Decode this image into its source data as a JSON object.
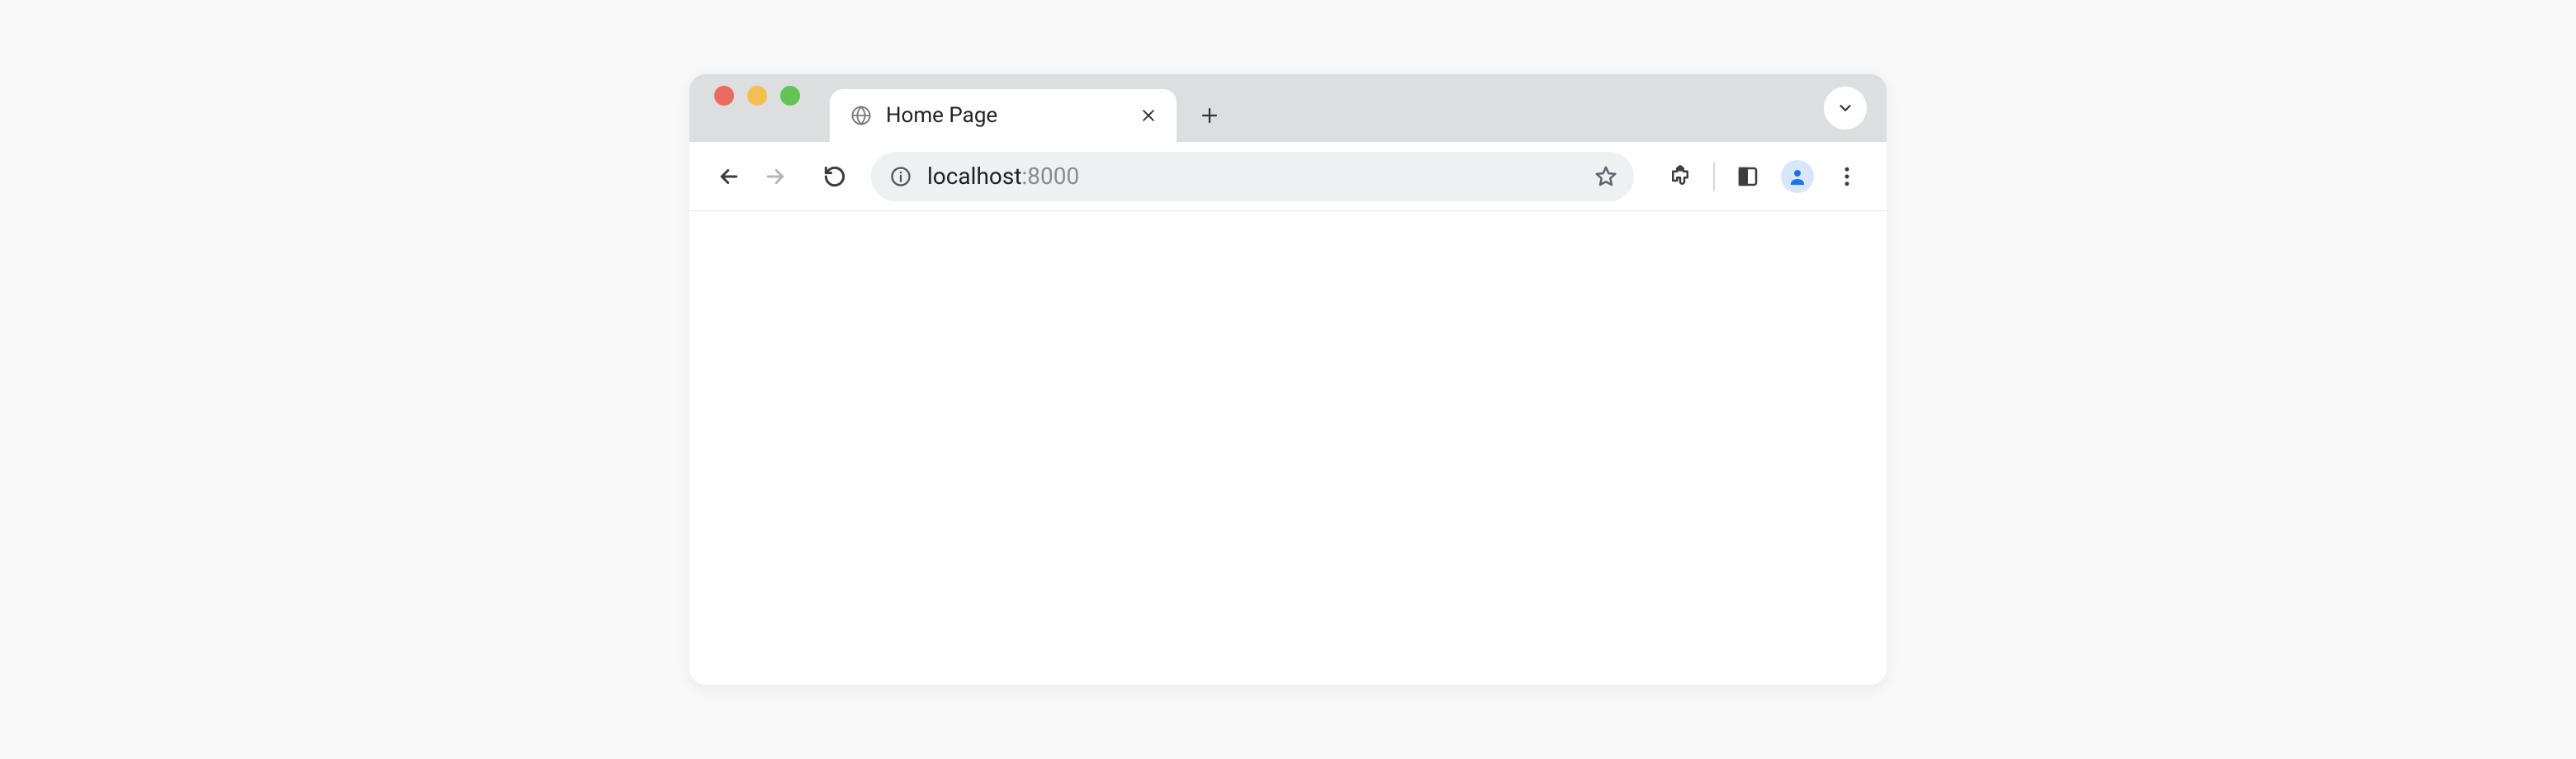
{
  "tab": {
    "title": "Home Page"
  },
  "address": {
    "host": "localhost",
    "port_suffix": ":8000"
  }
}
